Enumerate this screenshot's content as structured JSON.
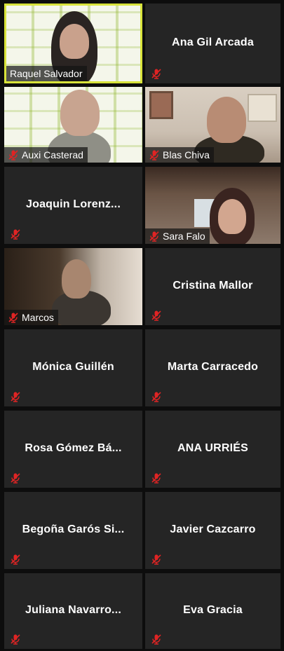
{
  "participants": [
    {
      "name": "Raquel Salvador",
      "video": true,
      "active": true,
      "muted": true
    },
    {
      "name": "Ana Gil Arcada",
      "video": false,
      "muted": true
    },
    {
      "name": "Auxi Casterad",
      "video": true,
      "muted": true
    },
    {
      "name": "Blas Chiva",
      "video": true,
      "muted": true
    },
    {
      "name": "Joaquin  Lorenz...",
      "video": false,
      "muted": true
    },
    {
      "name": "Sara Falo",
      "video": true,
      "muted": true
    },
    {
      "name": "Marcos",
      "video": true,
      "muted": true
    },
    {
      "name": "Cristina Mallor",
      "video": false,
      "muted": true
    },
    {
      "name": "Mónica Guillén",
      "video": false,
      "muted": true
    },
    {
      "name": "Marta Carracedo",
      "video": false,
      "muted": true
    },
    {
      "name": "Rosa Gómez Bá...",
      "video": false,
      "muted": true
    },
    {
      "name": "ANA URRIÉS",
      "video": false,
      "muted": true
    },
    {
      "name": "Begoña  Garós  Si...",
      "video": false,
      "muted": true
    },
    {
      "name": "Javier Cazcarro",
      "video": false,
      "muted": true
    },
    {
      "name": "Juliana  Navarro...",
      "video": false,
      "muted": true
    },
    {
      "name": "Eva Gracia",
      "video": false,
      "muted": true
    }
  ],
  "colors": {
    "active_border": "#d8e33a",
    "mic_muted": "#e02424",
    "tile_bg": "#252525",
    "page_bg": "#0d0d0d"
  },
  "icons": {
    "mic": "microphone-muted-icon"
  }
}
